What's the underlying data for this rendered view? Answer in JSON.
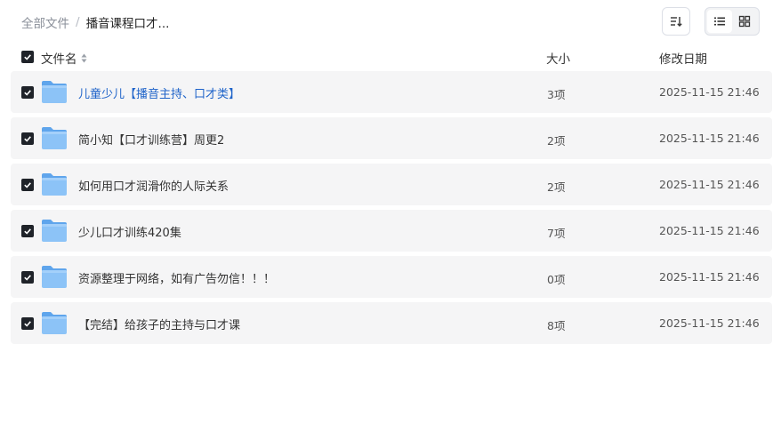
{
  "breadcrumb": {
    "root": "全部文件",
    "separator": "/",
    "current": "播音课程口才..."
  },
  "header": {
    "name": "文件名",
    "size": "大小",
    "date": "修改日期"
  },
  "rows": [
    {
      "name": "儿童少儿【播音主持、口才类】",
      "size": "3项",
      "date": "2025-11-15 21:46"
    },
    {
      "name": "简小知【口才训练营】周更2",
      "size": "2项",
      "date": "2025-11-15 21:46"
    },
    {
      "name": "如何用口才润滑你的人际关系",
      "size": "2项",
      "date": "2025-11-15 21:46"
    },
    {
      "name": "少儿口才训练420集",
      "size": "7项",
      "date": "2025-11-15 21:46"
    },
    {
      "name": "资源整理于网络，如有广告勿信！！！",
      "size": "0项",
      "date": "2025-11-15 21:46"
    },
    {
      "name": "【完结】给孩子的主持与口才课",
      "size": "8项",
      "date": "2025-11-15 21:46"
    }
  ],
  "colors": {
    "link": "#1e63c9",
    "row_bg": "#f5f5f6",
    "checkbox": "#1f2329",
    "folder": "#7ab8f5"
  },
  "icons": [
    "sort-icon",
    "list-view-icon",
    "grid-view-icon",
    "folder-icon",
    "check-icon"
  ]
}
